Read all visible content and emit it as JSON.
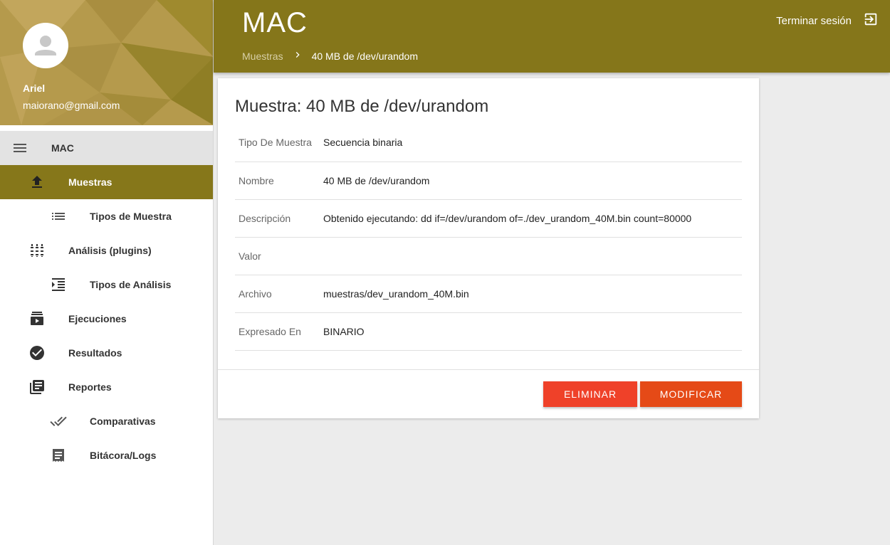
{
  "profile": {
    "name": "Ariel",
    "email": "maiorano@gmail.com"
  },
  "menu_header": {
    "icon": "menu-icon",
    "label": "MAC"
  },
  "nav": [
    {
      "label": "Muestras",
      "icon": "upload-icon",
      "active": true,
      "level": 1
    },
    {
      "label": "Tipos de Muestra",
      "icon": "list-icon",
      "active": false,
      "level": 2
    },
    {
      "label": "Análisis (plugins)",
      "icon": "equalizer-icon",
      "active": false,
      "level": 1
    },
    {
      "label": "Tipos de Análisis",
      "icon": "format-indent-icon",
      "active": false,
      "level": 2
    },
    {
      "label": "Ejecuciones",
      "icon": "queue-play-icon",
      "active": false,
      "level": 1
    },
    {
      "label": "Resultados",
      "icon": "check-circle-icon",
      "active": false,
      "level": 1
    },
    {
      "label": "Reportes",
      "icon": "library-books-icon",
      "active": false,
      "level": 1
    },
    {
      "label": "Comparativas",
      "icon": "done-all-icon",
      "active": false,
      "level": 2
    },
    {
      "label": "Bitácora/Logs",
      "icon": "receipt-icon",
      "active": false,
      "level": 2
    }
  ],
  "header": {
    "title": "MAC",
    "logout_label": "Terminar sesión",
    "breadcrumb": [
      "Muestras",
      "40 MB de /dev/urandom"
    ]
  },
  "card": {
    "title": "Muestra: 40 MB de /dev/urandom",
    "rows": [
      {
        "key": "Tipo De Muestra",
        "value": "Secuencia binaria"
      },
      {
        "key": "Nombre",
        "value": "40 MB de /dev/urandom"
      },
      {
        "key": "Descripción",
        "value": "Obtenido ejecutando: dd if=/dev/urandom of=./dev_urandom_40M.bin count=80000"
      },
      {
        "key": "Valor",
        "value": ""
      },
      {
        "key": "Archivo",
        "value": "muestras/dev_urandom_40M.bin"
      },
      {
        "key": "Expresado En",
        "value": "BINARIO"
      }
    ],
    "delete_label": "Eliminar",
    "modify_label": "Modificar"
  },
  "colors": {
    "primary": "#85761a",
    "accent": "#e54a17",
    "delete": "#ef4129",
    "profile_bg": "#b59a4c"
  }
}
